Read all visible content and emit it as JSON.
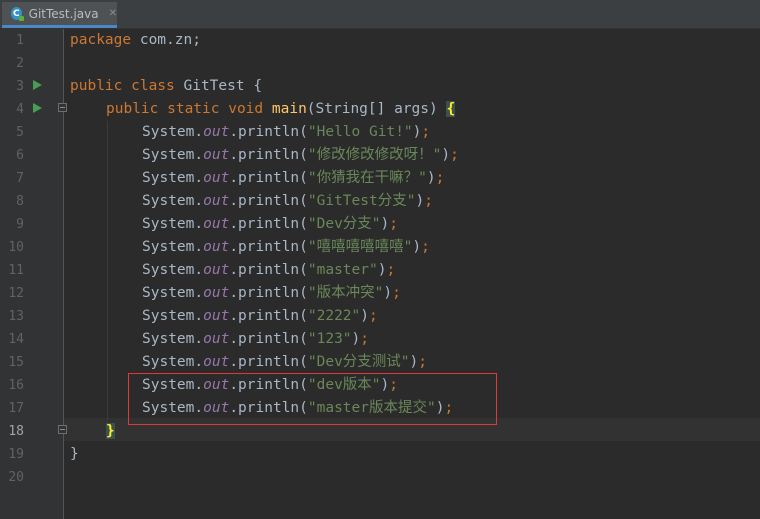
{
  "tab": {
    "label": "GitTest.java",
    "icon": "java-class-icon",
    "close": "✕"
  },
  "line_numbers": [
    "1",
    "2",
    "3",
    "4",
    "5",
    "6",
    "7",
    "8",
    "9",
    "10",
    "11",
    "12",
    "13",
    "14",
    "15",
    "16",
    "17",
    "18",
    "19",
    "20"
  ],
  "code": {
    "l1_kw": "package",
    "l1_rest": " com.zn;",
    "l3_kw": "public class",
    "l3_rest": " GitTest {",
    "l4_kw": "public static void",
    "l4_fn": "main",
    "l4_rest": "(String[] args) ",
    "l4_brace": "{",
    "sys": "System.",
    "out": "out",
    "println": ".println(",
    "strings": [
      "\"Hello Git!\"",
      "\"修改修改修改呀！\"",
      "\"你猜我在干嘛？\"",
      "\"GitTest分支\"",
      "\"Dev分支\"",
      "\"嘻嘻嘻嘻嘻嘻\"",
      "\"master\"",
      "\"版本冲突\"",
      "\"2222\"",
      "\"123\"",
      "\"Dev分支测试\"",
      "\"dev版本\"",
      "\"master版本提交\""
    ],
    "close_paren": ")",
    "semicolon": ";",
    "l18_brace": "}",
    "l19_brace": "}"
  },
  "colors": {
    "keyword": "#cc7832",
    "string": "#6a8759",
    "field": "#9876aa",
    "method": "#ffc66d",
    "highlight_box": "#e0383a"
  }
}
